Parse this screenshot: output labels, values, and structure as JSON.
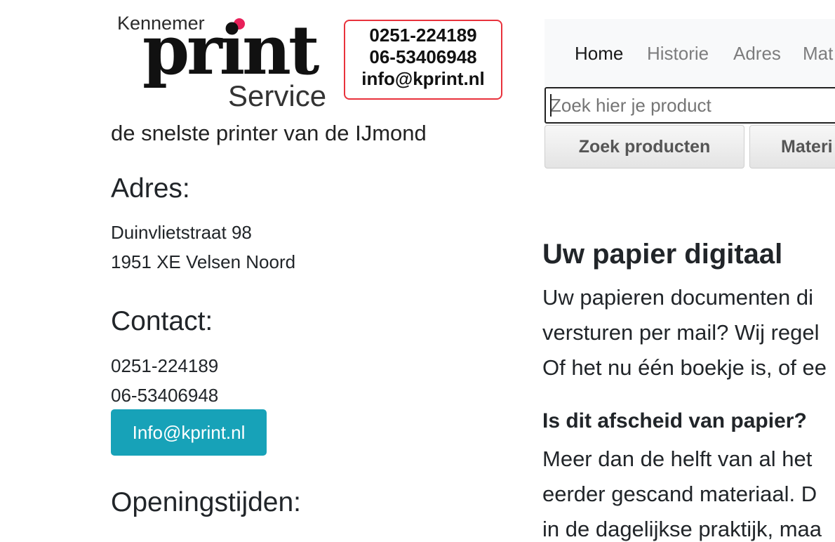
{
  "logo": {
    "brand_top": "Kennemer",
    "brand_main": "print",
    "brand_sub": "Service",
    "box_phone": "0251-224189",
    "box_mobile": "06-53406948",
    "box_email": "info@kprint.nl"
  },
  "tagline": "de snelste printer van de IJmond",
  "address": {
    "heading": "Adres:",
    "street": "Duinvlietstraat 98",
    "city": "1951 XE Velsen Noord"
  },
  "contact": {
    "heading": "Contact:",
    "phone": "0251-224189",
    "mobile": "06-53406948",
    "email_button": "Info@kprint.nl"
  },
  "hours": {
    "heading": "Openingstijden:"
  },
  "nav": {
    "items": [
      "Home",
      "Historie",
      "Adres",
      "Mat"
    ],
    "active": "Home"
  },
  "search": {
    "placeholder": "Zoek hier je product",
    "value": ""
  },
  "buttons": {
    "search_products": "Zoek producten",
    "materials": "Materi"
  },
  "article": {
    "heading": "Uw papier digitaal",
    "paragraph1": [
      "Uw papieren documenten di",
      "versturen per mail? Wij regel",
      "Of het nu één boekje is, of ee"
    ],
    "subheading": "Is dit afscheid van papier?",
    "paragraph2": [
      "Meer dan de helft van al het",
      "eerder gescand materiaal. D",
      "in de dagelijkse praktijk, maa"
    ]
  },
  "colors": {
    "accent": "#17a2b8",
    "logo_red": "#e8323c",
    "logo_dot": "#e8215a",
    "navbar_bg": "#f8f9fa"
  }
}
